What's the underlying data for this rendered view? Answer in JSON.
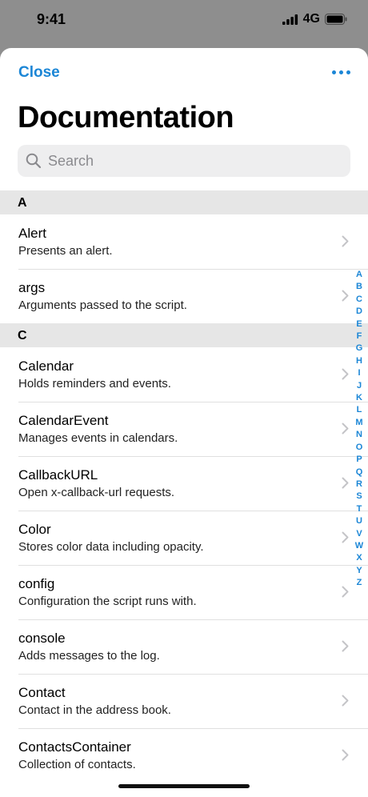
{
  "status": {
    "time": "9:41",
    "network": "4G"
  },
  "nav": {
    "close_label": "Close"
  },
  "page": {
    "title": "Documentation"
  },
  "search": {
    "placeholder": "Search"
  },
  "sections": [
    {
      "header": "A",
      "items": [
        {
          "title": "Alert",
          "subtitle": "Presents an alert."
        },
        {
          "title": "args",
          "subtitle": "Arguments passed to the script."
        }
      ]
    },
    {
      "header": "C",
      "items": [
        {
          "title": "Calendar",
          "subtitle": "Holds reminders and events."
        },
        {
          "title": "CalendarEvent",
          "subtitle": "Manages events in calendars."
        },
        {
          "title": "CallbackURL",
          "subtitle": "Open x-callback-url requests."
        },
        {
          "title": "Color",
          "subtitle": "Stores color data including opacity."
        },
        {
          "title": "config",
          "subtitle": "Configuration the script runs with."
        },
        {
          "title": "console",
          "subtitle": "Adds messages to the log."
        },
        {
          "title": "Contact",
          "subtitle": "Contact in the address book."
        },
        {
          "title": "ContactsContainer",
          "subtitle": "Collection of contacts."
        }
      ]
    }
  ],
  "index_letters": [
    "A",
    "B",
    "C",
    "D",
    "E",
    "F",
    "G",
    "H",
    "I",
    "J",
    "K",
    "L",
    "M",
    "N",
    "O",
    "P",
    "Q",
    "R",
    "S",
    "T",
    "U",
    "V",
    "W",
    "X",
    "Y",
    "Z"
  ],
  "colors": {
    "accent": "#1b86d6",
    "section_bg": "#e6e6e6",
    "search_bg": "#eeeeef",
    "backdrop": "#8e8e8e"
  },
  "icons": {
    "more": "ellipsis-icon",
    "search": "search-icon",
    "row": "chevron-right-icon"
  }
}
